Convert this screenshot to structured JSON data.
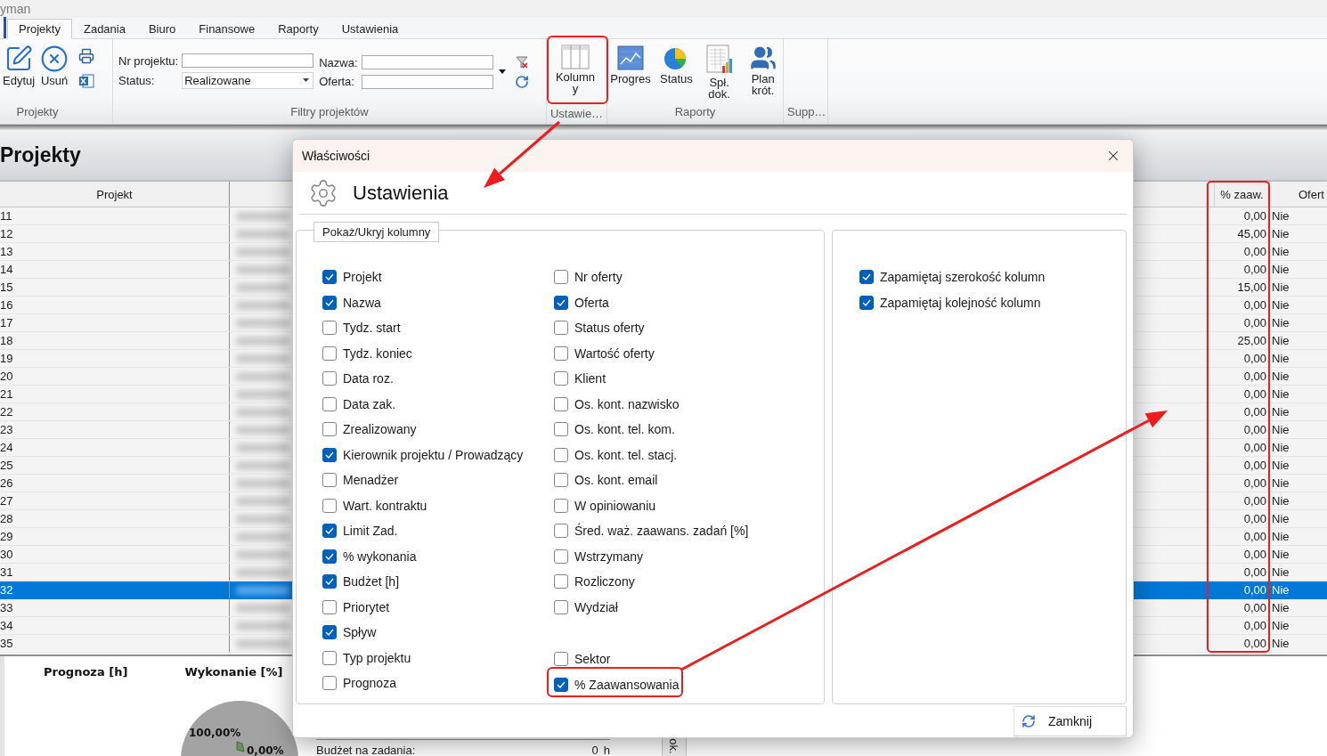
{
  "window": {
    "title": "yman"
  },
  "tabs": [
    {
      "label": "Projekty",
      "selected": true
    },
    {
      "label": "Zadania",
      "selected": false
    },
    {
      "label": "Biuro",
      "selected": false
    },
    {
      "label": "Finansowe",
      "selected": false
    },
    {
      "label": "Raporty",
      "selected": false
    },
    {
      "label": "Ustawienia",
      "selected": false
    }
  ],
  "ribbon": {
    "projects_group": {
      "label": "Projekty",
      "buttons": [
        {
          "label": "Edytuj",
          "kind": "edit"
        },
        {
          "label": "Usuń",
          "kind": "delete"
        }
      ]
    },
    "filters_group": {
      "label": "Filtry projektów",
      "nr_projektu": {
        "label": "Nr projektu:"
      },
      "status": {
        "label": "Status:",
        "value": "Realizowane"
      },
      "nazwa": {
        "label": "Nazwa:"
      },
      "oferta": {
        "label": "Oferta:"
      }
    },
    "settings_group": {
      "label": "Ustawie…",
      "button": "Kolumny"
    },
    "reports_group": {
      "label": "Raporty",
      "buttons": [
        {
          "label": "Progres",
          "kind": "progress"
        },
        {
          "label": "Status",
          "kind": "status"
        },
        {
          "label": "Spł. dok.",
          "kind": "docs"
        },
        {
          "label": "Plan krót.",
          "kind": "plan"
        }
      ]
    },
    "support_group": {
      "label": "Supp…"
    }
  },
  "page_header": {
    "title": "Projekty"
  },
  "table": {
    "columns": [
      {
        "label": "Projekt"
      },
      {
        "label": "% zaaw."
      },
      {
        "label": "Ofert"
      }
    ],
    "rows": [
      {
        "projekt": "11",
        "zaaw": "0,00",
        "oferta": "Nie",
        "selected": false
      },
      {
        "projekt": "12",
        "zaaw": "45,00",
        "oferta": "Nie",
        "selected": false
      },
      {
        "projekt": "13",
        "zaaw": "0,00",
        "oferta": "Nie",
        "selected": false
      },
      {
        "projekt": "14",
        "zaaw": "0,00",
        "oferta": "Nie",
        "selected": false
      },
      {
        "projekt": "15",
        "zaaw": "15,00",
        "oferta": "Nie",
        "selected": false
      },
      {
        "projekt": "16",
        "zaaw": "0,00",
        "oferta": "Nie",
        "selected": false
      },
      {
        "projekt": "17",
        "zaaw": "0,00",
        "oferta": "Nie",
        "selected": false
      },
      {
        "projekt": "18",
        "zaaw": "25,00",
        "oferta": "Nie",
        "selected": false
      },
      {
        "projekt": "19",
        "zaaw": "0,00",
        "oferta": "Nie",
        "selected": false
      },
      {
        "projekt": "20",
        "zaaw": "0,00",
        "oferta": "Nie",
        "selected": false
      },
      {
        "projekt": "21",
        "zaaw": "0,00",
        "oferta": "Nie",
        "selected": false
      },
      {
        "projekt": "22",
        "zaaw": "0,00",
        "oferta": "Nie",
        "selected": false
      },
      {
        "projekt": "23",
        "zaaw": "0,00",
        "oferta": "Nie",
        "selected": false
      },
      {
        "projekt": "24",
        "zaaw": "0,00",
        "oferta": "Nie",
        "selected": false
      },
      {
        "projekt": "25",
        "zaaw": "0,00",
        "oferta": "Nie",
        "selected": false
      },
      {
        "projekt": "26",
        "zaaw": "0,00",
        "oferta": "Nie",
        "selected": false
      },
      {
        "projekt": "27",
        "zaaw": "0,00",
        "oferta": "Nie",
        "selected": false
      },
      {
        "projekt": "28",
        "zaaw": "0,00",
        "oferta": "Nie",
        "selected": false
      },
      {
        "projekt": "29",
        "zaaw": "0,00",
        "oferta": "Nie",
        "selected": false
      },
      {
        "projekt": "30",
        "zaaw": "0,00",
        "oferta": "Nie",
        "selected": false
      },
      {
        "projekt": "31",
        "zaaw": "0,00",
        "oferta": "Nie",
        "selected": false
      },
      {
        "projekt": "32",
        "zaaw": "0,00",
        "oferta": "Nie",
        "selected": true
      },
      {
        "projekt": "33",
        "zaaw": "0,00",
        "oferta": "Nie",
        "selected": false
      },
      {
        "projekt": "34",
        "zaaw": "0,00",
        "oferta": "Nie",
        "selected": false
      },
      {
        "projekt": "35",
        "zaaw": "0,00",
        "oferta": "Nie",
        "selected": false
      }
    ]
  },
  "summary": {
    "forecast_title": "Prognoza [h]",
    "progress_title": "Wykonanie [%]",
    "chart_data": {
      "type": "pie",
      "values": [
        100,
        0
      ],
      "value_labels": [
        "100,00%",
        "0,00%"
      ]
    },
    "budget_label": "Budżet na zadania:",
    "budget_value": "0",
    "budget_unit": "h",
    "side_label": "ok."
  },
  "dialog": {
    "title": "Właściwości",
    "heading": "Ustawienia",
    "group_label": "Pokaż/Ukryj kolumny",
    "columns_left": [
      {
        "label": "Projekt",
        "checked": true
      },
      {
        "label": "Nazwa",
        "checked": true
      },
      {
        "label": "Tydz. start",
        "checked": false
      },
      {
        "label": "Tydz. koniec",
        "checked": false
      },
      {
        "label": "Data roz.",
        "checked": false
      },
      {
        "label": "Data zak.",
        "checked": false
      },
      {
        "label": "Zrealizowany",
        "checked": false
      },
      {
        "label": "Kierownik projektu / Prowadzący",
        "checked": true
      },
      {
        "label": "Menadżer",
        "checked": false
      },
      {
        "label": "Wart. kontraktu",
        "checked": false
      },
      {
        "label": "Limit Zad.",
        "checked": true
      },
      {
        "label": "% wykonania",
        "checked": true
      },
      {
        "label": "Budżet [h]",
        "checked": true
      },
      {
        "label": "Priorytet",
        "checked": false
      },
      {
        "label": "Spływ",
        "checked": true
      },
      {
        "label": "Typ projektu",
        "checked": false
      },
      {
        "label": "Prognoza",
        "checked": false
      }
    ],
    "columns_right": [
      {
        "label": "Nr oferty",
        "checked": false
      },
      {
        "label": "Oferta",
        "checked": true
      },
      {
        "label": "Status oferty",
        "checked": false
      },
      {
        "label": "Wartość oferty",
        "checked": false
      },
      {
        "label": "Klient",
        "checked": false
      },
      {
        "label": "Os. kont. nazwisko",
        "checked": false
      },
      {
        "label": "Os. kont. tel. kom.",
        "checked": false
      },
      {
        "label": "Os. kont. tel. stacj.",
        "checked": false
      },
      {
        "label": "Os. kont. email",
        "checked": false
      },
      {
        "label": "W opiniowaniu",
        "checked": false
      },
      {
        "label": "Śred. waż. zaawans. zadań [%]",
        "checked": false
      },
      {
        "label": "Wstrzymany",
        "checked": false
      },
      {
        "label": "Rozliczony",
        "checked": false
      },
      {
        "label": "Wydział",
        "checked": false
      }
    ],
    "columns_right_bottom": [
      {
        "label": "Sektor",
        "checked": false
      },
      {
        "label": "% Zaawansowania",
        "checked": true
      }
    ],
    "options": [
      {
        "label": "Zapamiętaj szerokość kolumn",
        "checked": true
      },
      {
        "label": "Zapamiętaj kolejność kolumn",
        "checked": true
      }
    ],
    "close_button": "Zamknij"
  }
}
